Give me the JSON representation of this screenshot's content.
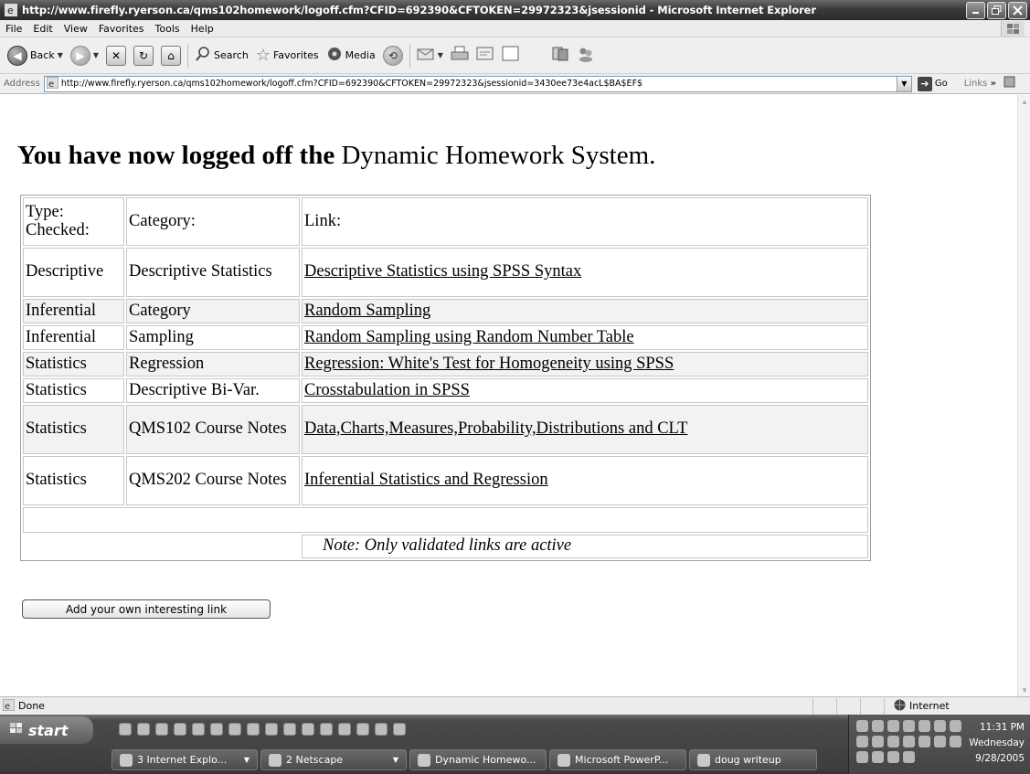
{
  "window": {
    "title": "http://www.firefly.ryerson.ca/qms102homework/logoff.cfm?CFID=692390&CFTOKEN=29972323&jsessionid - Microsoft Internet Explorer"
  },
  "menu": {
    "items": [
      "File",
      "Edit",
      "View",
      "Favorites",
      "Tools",
      "Help"
    ]
  },
  "toolbar": {
    "back_label": "Back",
    "search_label": "Search",
    "favorites_label": "Favorites",
    "media_label": "Media"
  },
  "address": {
    "label": "Address",
    "url": "http://www.firefly.ryerson.ca/qms102homework/logoff.cfm?CFID=692390&CFTOKEN=29972323&jsessionid=3430ee73e4acL$BA$EF$",
    "go_label": "Go",
    "links_label": "Links"
  },
  "page": {
    "heading_bold": "You have now logged off the",
    "heading_normal": "Dynamic Homework System.",
    "table": {
      "headers": [
        "Type: Checked:",
        "Category:",
        "Link:"
      ],
      "rows": [
        {
          "type": "Descriptive",
          "category": "Descriptive Statistics",
          "link": "Descriptive Statistics using SPSS Syntax"
        },
        {
          "type": "Inferential",
          "category": "Category",
          "link": "Random Sampling"
        },
        {
          "type": "Inferential",
          "category": "Sampling",
          "link": "Random Sampling using Random Number Table"
        },
        {
          "type": "Statistics",
          "category": "Regression",
          "link": "Regression: White's Test for Homogeneity using SPSS"
        },
        {
          "type": "Statistics",
          "category": "Descriptive Bi-Var.",
          "link": "Crosstabulation in SPSS"
        },
        {
          "type": "Statistics",
          "category": "QMS102 Course Notes",
          "link": "Data,Charts,Measures,Probability,Distributions and CLT"
        },
        {
          "type": "Statistics",
          "category": "QMS202 Course Notes",
          "link": "Inferential Statistics and Regression"
        }
      ],
      "note": "Note: Only validated links are active"
    },
    "add_link_button": "Add your own interesting link"
  },
  "status": {
    "text": "Done",
    "zone": "Internet"
  },
  "taskbar": {
    "start_label": "start",
    "tasks": [
      "3 Internet Explo...",
      "2 Netscape",
      "Dynamic Homewo...",
      "Microsoft PowerP...",
      "doug writeup"
    ],
    "clock_time": "11:31 PM",
    "clock_day": "Wednesday",
    "clock_date": "9/28/2005"
  }
}
